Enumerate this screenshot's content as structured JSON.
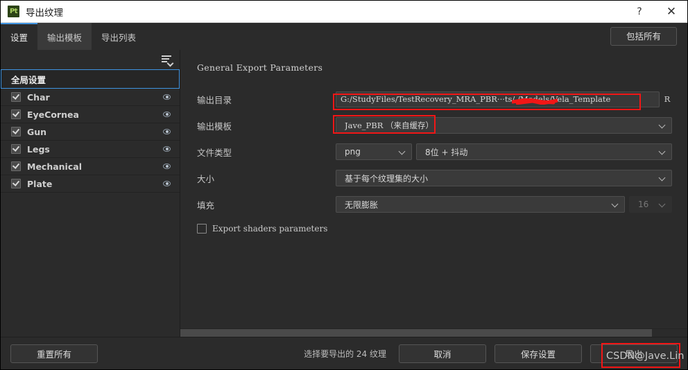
{
  "window": {
    "title": "导出纹理",
    "app_icon_label": "Pt",
    "help_label": "?",
    "close_label": "✕"
  },
  "tabs": {
    "items": [
      {
        "label": "设置",
        "state": "active"
      },
      {
        "label": "输出模板",
        "state": "hover"
      },
      {
        "label": "导出列表",
        "state": "normal"
      }
    ],
    "include_all_label": "包括所有"
  },
  "sidebar": {
    "filter_icon": "list-filter-icon",
    "global_row": {
      "label": "全局设置"
    },
    "items": [
      {
        "label": "Char",
        "checked": true,
        "eye": "eye-icon"
      },
      {
        "label": "EyeCornea",
        "checked": true,
        "eye": "eye-icon"
      },
      {
        "label": "Gun",
        "checked": true,
        "eye": "eye-icon"
      },
      {
        "label": "Legs",
        "checked": true,
        "eye": "eye-icon"
      },
      {
        "label": "Mechanical",
        "checked": true,
        "eye": "eye-icon"
      },
      {
        "label": "Plate",
        "checked": true,
        "eye": "eye-icon"
      }
    ]
  },
  "main": {
    "section_title": "General Export Parameters",
    "fields": {
      "output_dir": {
        "label": "输出目录",
        "value": "G:/StudyFiles/TestRecovery_MRA_PBR···ts/            /Models/Vela_Template",
        "browse_label": "R"
      },
      "output_template": {
        "label": "输出模板",
        "value": "Jave_PBR （来自缓存）"
      },
      "file_type": {
        "label": "文件类型",
        "format_value": "png",
        "depth_value": "8位 + 抖动"
      },
      "size": {
        "label": "大小",
        "value": "基于每个纹理集的大小"
      },
      "padding": {
        "label": "填充",
        "value": "无限膨胀",
        "amount_value": "16",
        "amount_disabled": true
      },
      "export_shaders": {
        "label": "Export shaders parameters",
        "checked": false
      }
    }
  },
  "footer": {
    "reset_label": "重置所有",
    "status_text": "选择要导出的 24 纹理",
    "cancel_label": "取消",
    "save_label": "保存设置",
    "export_label": "导出"
  },
  "annotations": {
    "watermark": "CSDN@Jave.Lin",
    "highlight_color": "#f21616",
    "redaction_color": "#f21616"
  },
  "colors": {
    "accent": "#3f94e2",
    "window_bg": "#2b2b2b",
    "titlebar_bg": "#ffffff"
  }
}
